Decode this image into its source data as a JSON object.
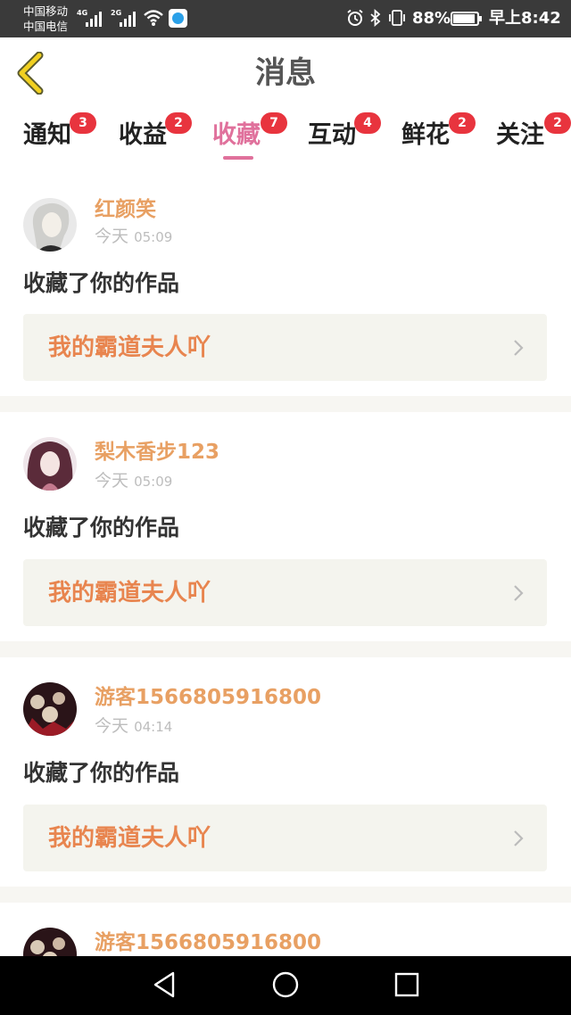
{
  "status_bar": {
    "carrier_1": "中国移动",
    "carrier_2": "中国电信",
    "net_1": "4G",
    "net_2": "2G",
    "battery_percent": "88%",
    "time": "早上8:42"
  },
  "header": {
    "title": "消息",
    "back_icon": "chevron-left-icon"
  },
  "tabs": [
    {
      "label": "通知",
      "badge": "3"
    },
    {
      "label": "收益",
      "badge": "2"
    },
    {
      "label": "收藏",
      "badge": "7",
      "active": true
    },
    {
      "label": "互动",
      "badge": "4"
    },
    {
      "label": "鲜花",
      "badge": "2"
    },
    {
      "label": "关注",
      "badge": "2"
    }
  ],
  "messages": [
    {
      "user": "红颜笑",
      "time_day": "今天",
      "time_clock": "05:09",
      "action": "收藏了你的作品",
      "work": "我的霸道夫人吖"
    },
    {
      "user": "梨木香步123",
      "time_day": "今天",
      "time_clock": "05:09",
      "action": "收藏了你的作品",
      "work": "我的霸道夫人吖"
    },
    {
      "user": "游客1566805916800",
      "time_day": "今天",
      "time_clock": "04:14",
      "action": "收藏了你的作品",
      "work": "我的霸道夫人吖"
    },
    {
      "user": "游客1566805916800"
    }
  ],
  "colors": {
    "accent_pink": "#e0719c",
    "badge_red": "#e8343e",
    "name_orange": "#e8a063",
    "work_orange": "#e8854f",
    "back_yellow": "#f1c40f"
  }
}
